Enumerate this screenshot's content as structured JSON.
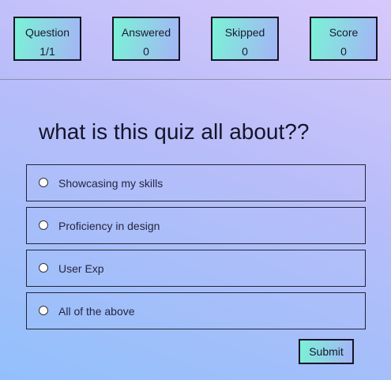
{
  "stats": {
    "question": {
      "label": "Question",
      "value": "1/1"
    },
    "answered": {
      "label": "Answered",
      "value": "0"
    },
    "skipped": {
      "label": "Skipped",
      "value": "0"
    },
    "score": {
      "label": "Score",
      "value": "0"
    }
  },
  "quiz": {
    "question": "what is this quiz all about??",
    "options": [
      {
        "label": "Showcasing my skills"
      },
      {
        "label": "Proficiency in design"
      },
      {
        "label": "User Exp"
      },
      {
        "label": "All of the above"
      }
    ],
    "submit_label": "Submit"
  },
  "colors": {
    "background_top": "#d7c8fb",
    "background_bottom": "#92c0fb",
    "accent_start": "#7af2d6",
    "accent_end": "#a5b4f6",
    "border": "#151525"
  }
}
